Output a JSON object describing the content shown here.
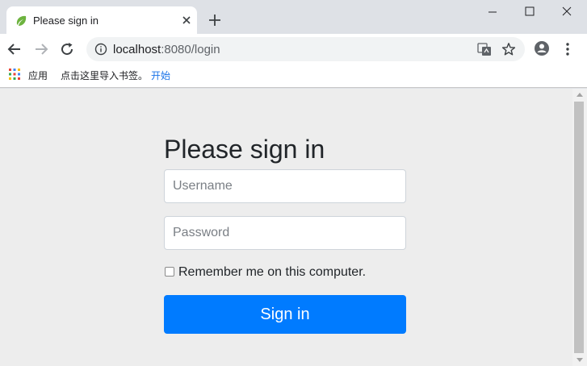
{
  "tab": {
    "title": "Please sign in",
    "favicon": "spring-leaf-icon"
  },
  "address_bar": {
    "host": "localhost",
    "rest": ":8080/login"
  },
  "bookmarks": {
    "apps_label": "应用",
    "hint": "点击这里导入书签。",
    "start_link": "开始"
  },
  "form": {
    "heading": "Please sign in",
    "username_placeholder": "Username",
    "password_placeholder": "Password",
    "remember_label": "Remember me on this computer.",
    "remember_checked": false,
    "submit_label": "Sign in"
  },
  "colors": {
    "primary": "#007bff",
    "page_bg": "#ededed",
    "chrome_bg": "#dee1e6"
  }
}
